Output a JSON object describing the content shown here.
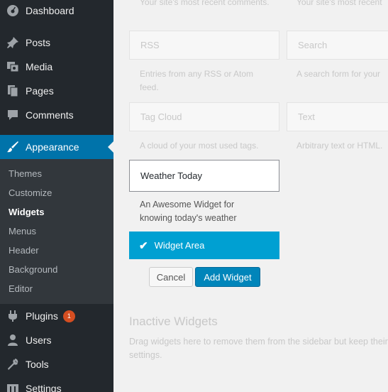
{
  "sidebar": {
    "menu": [
      {
        "label": "Dashboard",
        "icon": "dashboard-icon"
      },
      {
        "label": "Posts",
        "icon": "pin-icon"
      },
      {
        "label": "Media",
        "icon": "media-icon"
      },
      {
        "label": "Pages",
        "icon": "pages-icon"
      },
      {
        "label": "Comments",
        "icon": "comments-icon"
      },
      {
        "label": "Appearance",
        "icon": "brush-icon"
      },
      {
        "label": "Plugins",
        "icon": "plugin-icon",
        "badge": "1"
      },
      {
        "label": "Users",
        "icon": "user-icon"
      },
      {
        "label": "Tools",
        "icon": "wrench-icon"
      },
      {
        "label": "Settings",
        "icon": "settings-icon"
      }
    ],
    "submenu": [
      "Themes",
      "Customize",
      "Widgets",
      "Menus",
      "Header",
      "Background",
      "Editor"
    ],
    "accent": "#0073aa"
  },
  "widgets": {
    "top_desc_left": "Your site's most recent comments.",
    "top_desc_right": "Your site's most recent",
    "rss_title": "RSS",
    "rss_desc": "Entries from any RSS or Atom feed.",
    "search_title": "Search",
    "search_desc": "A search form for your",
    "tagcloud_title": "Tag Cloud",
    "tagcloud_desc": "A cloud of your most used tags.",
    "text_title": "Text",
    "text_desc": "Arbitrary text or HTML."
  },
  "chooser": {
    "widget_title": "Weather Today",
    "widget_desc": "An Awesome Widget for knowing today's weather",
    "area_label": "Widget Area",
    "cancel_label": "Cancel",
    "add_label": "Add Widget",
    "accent": "#00a0d2"
  },
  "inactive": {
    "title": "Inactive Widgets",
    "desc": "Drag widgets here to remove them from the sidebar but keep their settings."
  }
}
